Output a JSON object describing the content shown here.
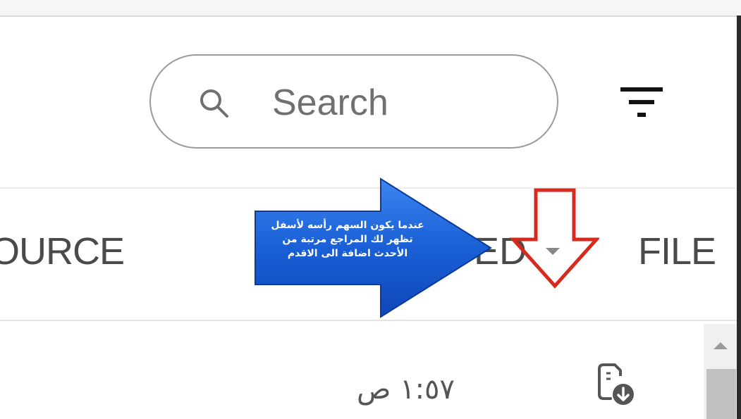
{
  "search": {
    "placeholder": "Search",
    "value": ""
  },
  "table": {
    "columns": [
      {
        "label": "OURCE"
      },
      {
        "label": "ED"
      },
      {
        "label": "FILE"
      }
    ],
    "rows": [
      {
        "time": "١:٥٧ ص"
      }
    ]
  },
  "annotation": {
    "text": "عندما يكون السهم رأسه لأسفل\nتظهر لك المراجع مرتبة من\nالأحدث اضافة الى الاقدم"
  },
  "icons": {
    "search": "search-icon",
    "filter": "filter-icon",
    "sort": "caret-down-icon",
    "file": "file-download-icon",
    "scroll_up": "scroll-up-arrow-icon"
  },
  "colors": {
    "callout_blue": "#1a5fd6",
    "annotation_red": "#d62a1f"
  }
}
